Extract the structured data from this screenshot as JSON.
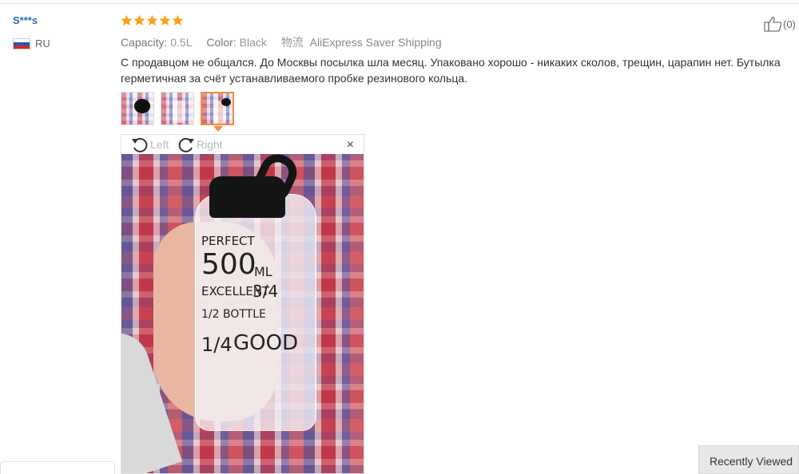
{
  "reviewer": {
    "name": "S***s",
    "country_code": "RU",
    "flag_colors": [
      "#ffffff",
      "#1f56c3",
      "#d52b1e"
    ]
  },
  "review": {
    "rating": 5,
    "star_color": "#f7a11a",
    "attributes": [
      {
        "key": "Capacity:",
        "value": "0.5L"
      },
      {
        "key": "Color:",
        "value": "Black"
      }
    ],
    "shipping_icon_text": "物流",
    "shipping": "AliExpress Saver Shipping",
    "text": "С продавцом не общался. До Москвы посылка шла месяц. Упаковано хорошо - никаких сколов, трещин, царапин нет. Бутылка герметичная за счёт устанавливаемого пробке резинового кольца.",
    "helpful_count": "(0)"
  },
  "gallery": {
    "thumbnail_count": 3,
    "selected_index": 2,
    "rotate_left_label": "Left",
    "rotate_right_label": "Right",
    "close_label": "×"
  },
  "photo": {
    "bottle_text": [
      "PERFECT",
      "500",
      "ML",
      "EXCELLENT",
      "3/4",
      "1/2 BOTTLE",
      "1/4",
      "GOOD"
    ]
  },
  "footer": {
    "recently_viewed": "Recently Viewed"
  },
  "colors": {
    "accent_border": "#f48c3c",
    "username": "#2a6db5"
  }
}
